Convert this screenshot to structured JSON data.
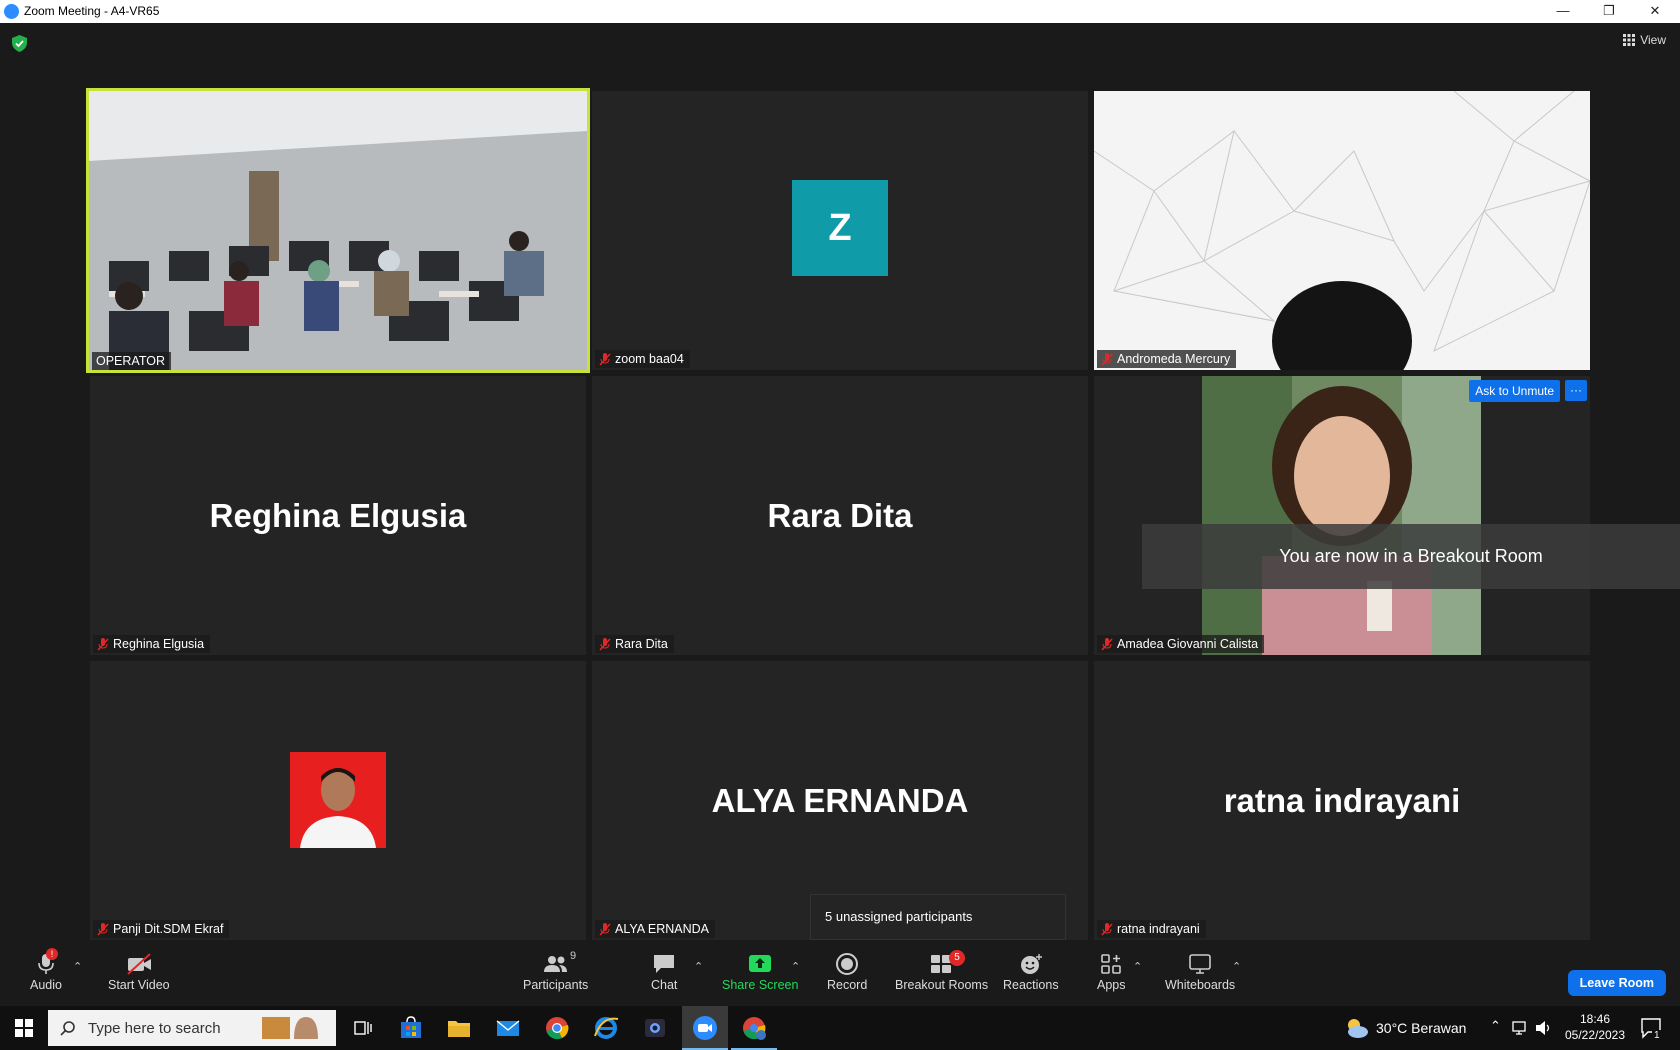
{
  "window": {
    "title": "Zoom Meeting - A4-VR65",
    "min": "—",
    "max": "❐",
    "close": "✕"
  },
  "view_label": "View",
  "tiles": {
    "operator": {
      "name": "OPERATOR"
    },
    "zoom_baa04": {
      "name": "zoom baa04",
      "initial": "Z"
    },
    "andromeda": {
      "name": "Andromeda Mercury"
    },
    "reghina": {
      "name": "Reghina Elgusia",
      "display": "Reghina Elgusia"
    },
    "rara": {
      "name": "Rara Dita",
      "display": "Rara Dita"
    },
    "amadea": {
      "name": "Amadea Giovanni Calista",
      "ask_unmute": "Ask to Unmute",
      "more": "···"
    },
    "panji": {
      "name": "Panji Dit.SDM Ekraf"
    },
    "alya": {
      "name": "ALYA ERNANDA",
      "display": "ALYA ERNANDA"
    },
    "ratna": {
      "name": "ratna indrayani",
      "display": "ratna indrayani"
    }
  },
  "toast": "You are now in a Breakout Room",
  "tooltip": "5 unassigned participants",
  "toolbar": {
    "audio": "Audio",
    "audio_badge": "!",
    "start_video": "Start Video",
    "participants": "Participants",
    "participants_count": "9",
    "chat": "Chat",
    "share_screen": "Share Screen",
    "record": "Record",
    "breakout_rooms": "Breakout Rooms",
    "breakout_badge": "5",
    "reactions": "Reactions",
    "apps": "Apps",
    "whiteboards": "Whiteboards",
    "leave": "Leave Room"
  },
  "taskbar": {
    "search_placeholder": "Type here to search",
    "weather": "30°C  Berawan",
    "time": "18:46",
    "date": "05/22/2023",
    "notif_count": "1"
  },
  "colors": {
    "accent": "#0e71eb",
    "share_green": "#23d959",
    "active_speaker": "#c6e23b",
    "badge_red": "#e02828"
  }
}
